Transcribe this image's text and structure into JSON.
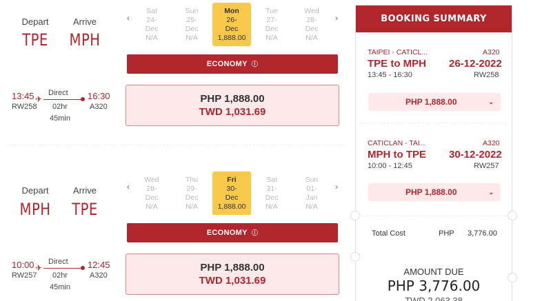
{
  "outbound": {
    "depart_label": "Depart",
    "arrive_label": "Arrive",
    "depart_code": "TPE",
    "arrive_code": "MPH",
    "depart_time": "13:45",
    "arrive_time": "16:30",
    "flight_no": "RW258",
    "aircraft": "A320",
    "stop_type": "Direct",
    "duration_hr": "02hr",
    "duration_min": "45min",
    "dates": [
      {
        "day": "Sat",
        "d": "24-",
        "m": "Dec",
        "price": "N/A"
      },
      {
        "day": "Sun",
        "d": "25-",
        "m": "Dec",
        "price": "N/A"
      },
      {
        "day": "Mon",
        "d": "26-",
        "m": "Dec",
        "price": "1,888.00"
      },
      {
        "day": "Tue",
        "d": "27-",
        "m": "Dec",
        "price": "N/A"
      },
      {
        "day": "Wed",
        "d": "28-",
        "m": "Dec",
        "price": "N/A"
      }
    ],
    "cabin": "ECONOMY",
    "fare_php": "PHP 1,888.00",
    "fare_twd": "TWD 1,031.69"
  },
  "inbound": {
    "depart_label": "Depart",
    "arrive_label": "Arrive",
    "depart_code": "MPH",
    "arrive_code": "TPE",
    "depart_time": "10:00",
    "arrive_time": "12:45",
    "flight_no": "RW257",
    "aircraft": "A320",
    "stop_type": "Direct",
    "duration_hr": "02hr",
    "duration_min": "45min",
    "dates": [
      {
        "day": "Wed",
        "d": "28-",
        "m": "Dec",
        "price": "N/A"
      },
      {
        "day": "Thu",
        "d": "29-",
        "m": "Dec",
        "price": "N/A"
      },
      {
        "day": "Fri",
        "d": "30-",
        "m": "Dec",
        "price": "1,888.00"
      },
      {
        "day": "Sat",
        "d": "31-",
        "m": "Dec",
        "price": "N/A"
      },
      {
        "day": "Sun",
        "d": "01-",
        "m": "Jan",
        "price": "N/A"
      }
    ],
    "cabin": "ECONOMY",
    "fare_php": "PHP 1,888.00",
    "fare_twd": "TWD 1,031.69"
  },
  "summary": {
    "title": "BOOKING SUMMARY",
    "leg1": {
      "route": "TAIPEI - CATICL...",
      "aircraft": "A320",
      "od": "TPE to MPH",
      "date": "26-12-2022",
      "times": "13:45 - 16:30",
      "flight_no": "RW258",
      "price": "PHP 1,888.00"
    },
    "leg2": {
      "route": "CATICLAN - TAI...",
      "aircraft": "A320",
      "od": "MPH to TPE",
      "date": "30-12-2022",
      "times": "10:00 - 12:45",
      "flight_no": "RW257",
      "price": "PHP 1,888.00"
    },
    "total_label": "Total Cost",
    "total_currency": "PHP",
    "total_value": "3,776.00",
    "amount_due_label": "AMOUNT DUE",
    "amount_due": "PHP 3,776.00",
    "amount_due_twd": "TWD 2,063.38"
  },
  "colors": {
    "brand": "#b1262c",
    "highlight": "#f8c84a",
    "fare_bg": "#fde8ea"
  },
  "icons": [
    "plane-icon",
    "chevron-left-icon",
    "chevron-right-icon",
    "info-icon",
    "chevron-down-icon"
  ]
}
